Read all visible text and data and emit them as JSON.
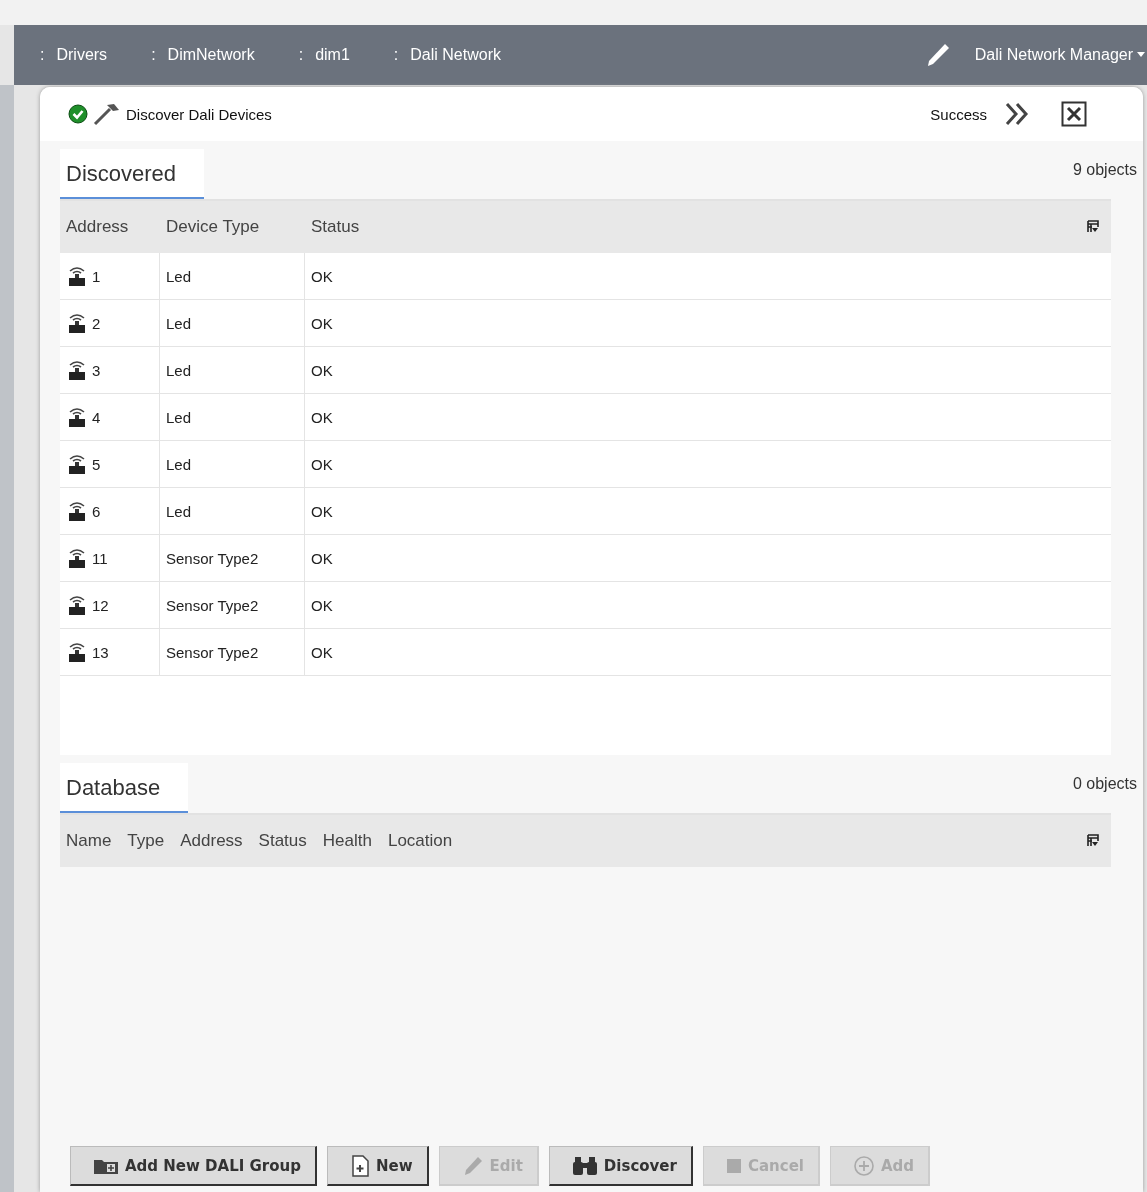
{
  "breadcrumbs": [
    {
      "sep": ":",
      "label": "Drivers"
    },
    {
      "sep": ":",
      "label": "DimNetwork"
    },
    {
      "sep": ":",
      "label": "dim1"
    },
    {
      "sep": ":",
      "label": "Dali Network"
    }
  ],
  "view_selector": {
    "label": "Dali Network Manager"
  },
  "job": {
    "title": "Discover Dali Devices",
    "status": "Success"
  },
  "discovered": {
    "tab": "Discovered",
    "count": "9 objects",
    "columns": [
      "Address",
      "Device Type",
      "Status"
    ],
    "rows": [
      {
        "address": "1",
        "device_type": "Led",
        "status": "OK"
      },
      {
        "address": "2",
        "device_type": "Led",
        "status": "OK"
      },
      {
        "address": "3",
        "device_type": "Led",
        "status": "OK"
      },
      {
        "address": "4",
        "device_type": "Led",
        "status": "OK"
      },
      {
        "address": "5",
        "device_type": "Led",
        "status": "OK"
      },
      {
        "address": "6",
        "device_type": "Led",
        "status": "OK"
      },
      {
        "address": "11",
        "device_type": "Sensor Type2",
        "status": "OK"
      },
      {
        "address": "12",
        "device_type": "Sensor Type2",
        "status": "OK"
      },
      {
        "address": "13",
        "device_type": "Sensor Type2",
        "status": "OK"
      }
    ]
  },
  "database": {
    "tab": "Database",
    "count": "0 objects",
    "columns": [
      "Name",
      "Type",
      "Address",
      "Status",
      "Health",
      "Location"
    ]
  },
  "buttons": [
    {
      "kind": "group",
      "label": "Add New DALI Group",
      "disabled": false
    },
    {
      "kind": "new",
      "label": "New",
      "disabled": false
    },
    {
      "kind": "edit",
      "label": "Edit",
      "disabled": true
    },
    {
      "kind": "discover",
      "label": "Discover",
      "disabled": false
    },
    {
      "kind": "cancel",
      "label": "Cancel",
      "disabled": true
    },
    {
      "kind": "add",
      "label": "Add",
      "disabled": true
    }
  ]
}
